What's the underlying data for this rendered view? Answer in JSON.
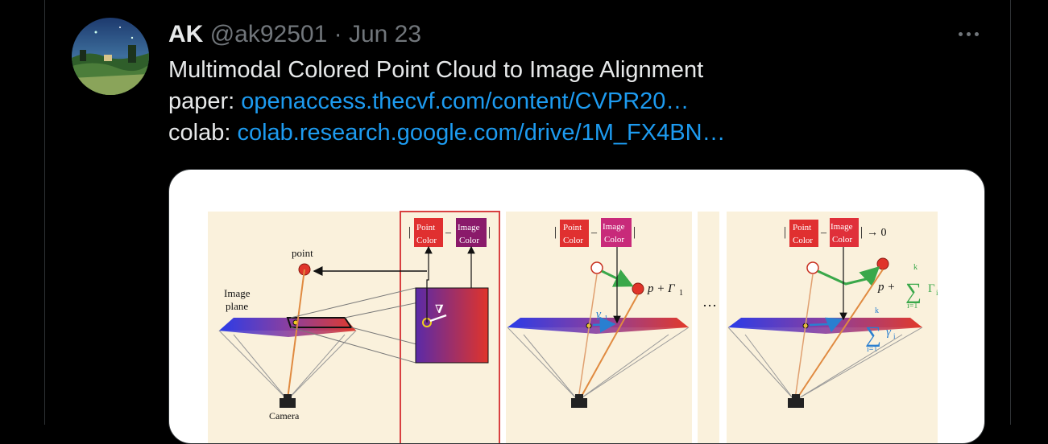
{
  "tweet": {
    "author_name": "AK",
    "handle": "@ak92501",
    "separator": "·",
    "date": "Jun 23",
    "title_line": "Multimodal Colored Point Cloud to Image Alignment",
    "paper_label": "paper:",
    "paper_link": "openaccess.thecvf.com/content/CVPR20…",
    "colab_label": "colab:",
    "colab_link": "colab.research.google.com/drive/1M_FX4BN…",
    "more_icon": "more-dots-icon",
    "link_color": "#1d9bf0"
  },
  "figure": {
    "point_label": "point",
    "image_label": "Image",
    "plane_label": "plane",
    "camera_label": "Camera",
    "point_word": "Point",
    "image_word": "Image",
    "color_word": "Color",
    "minus": "–",
    "arrow_zero": "→ 0",
    "grad_symbol": "∇",
    "gamma1": "γ",
    "gamma1_sub": "1",
    "p_plus_gamma": "p + Γ",
    "p_plus_gamma_sub": "1",
    "ellipsis": "…",
    "p_plus": "p +",
    "sum_symbol": "∑",
    "sum_top": "k",
    "sum_bottom": "i=1",
    "Gamma_i": "Γ",
    "gamma_i": "γ",
    "sub_i": "i",
    "camera_icon": "camera-icon"
  }
}
